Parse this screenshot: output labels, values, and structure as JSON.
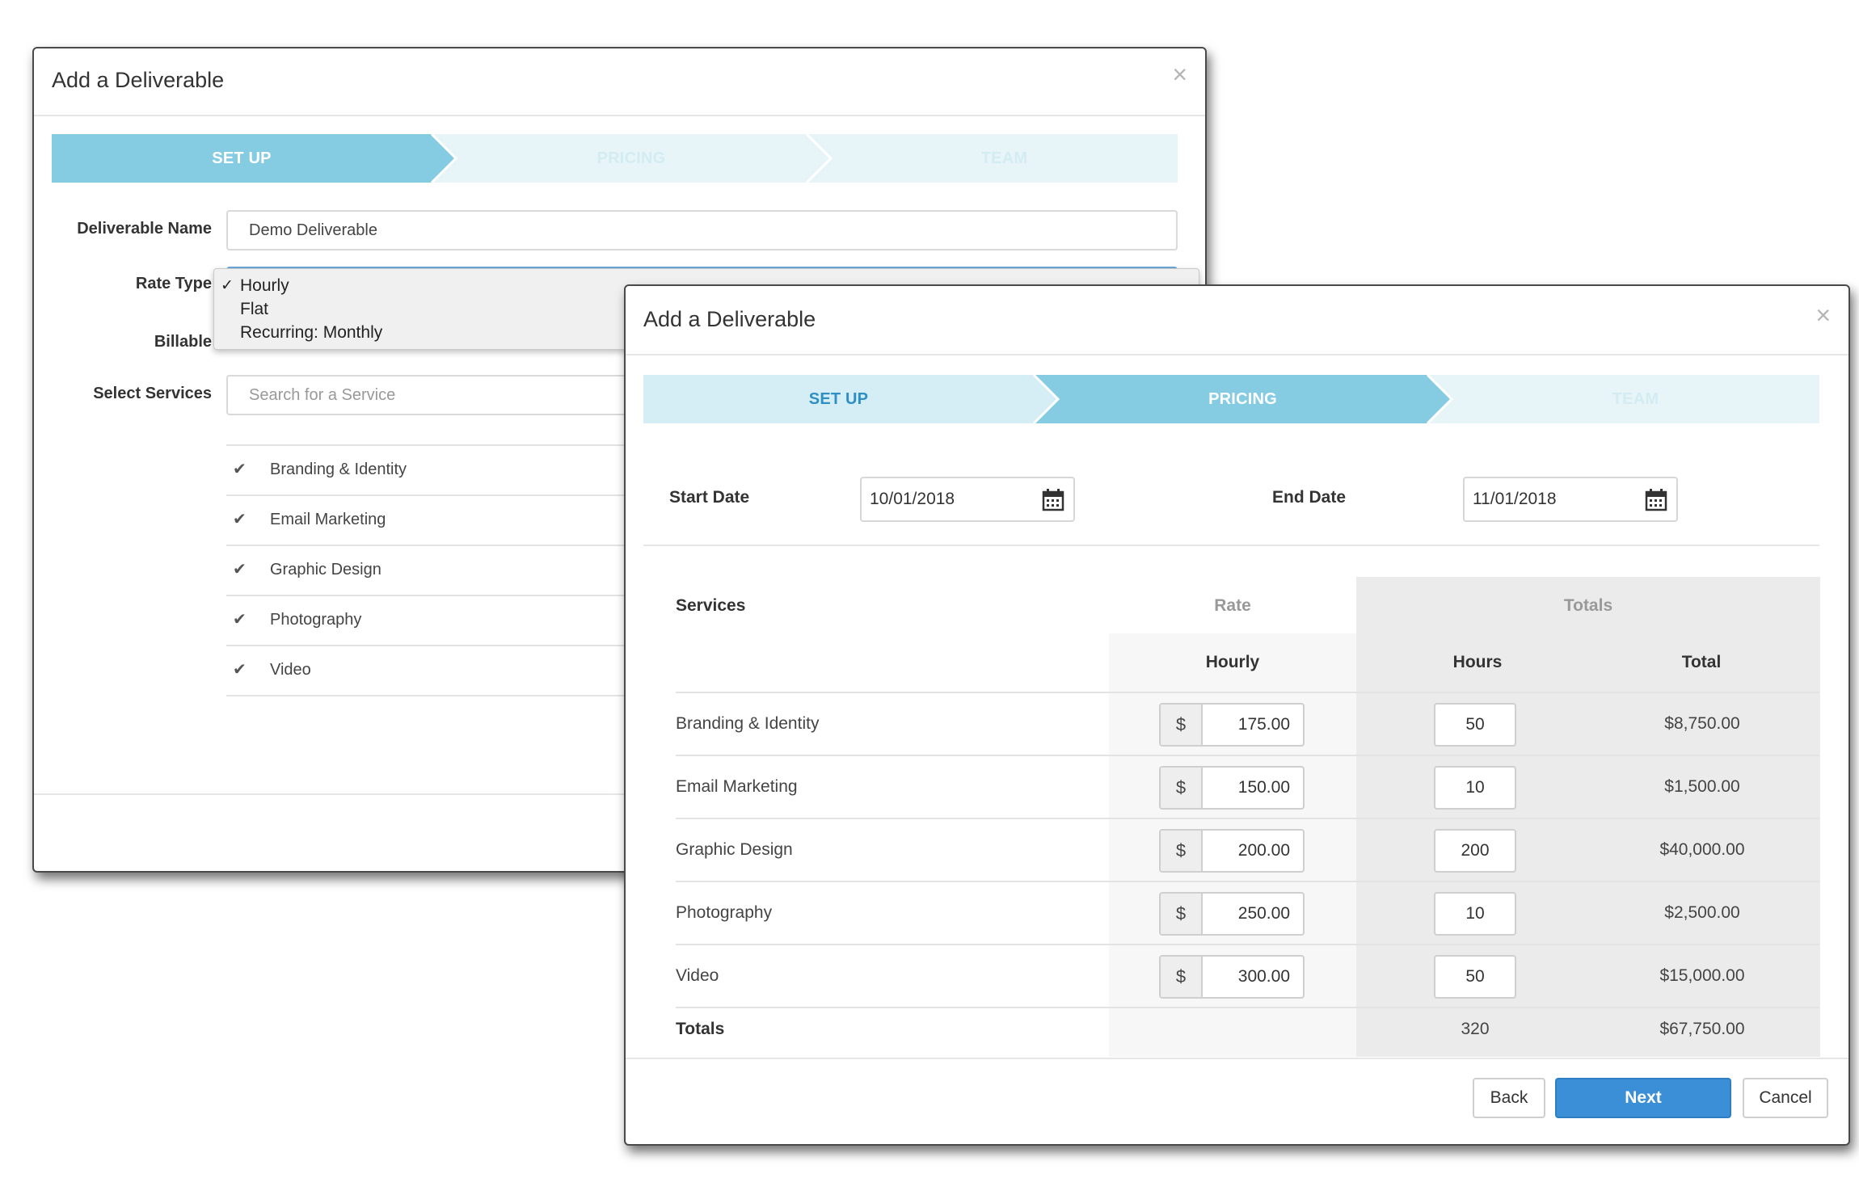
{
  "modal1": {
    "title": "Add a Deliverable",
    "close": "×",
    "steps": [
      "SET UP",
      "PRICING",
      "TEAM"
    ],
    "colors": {
      "active_step": "#85cce3",
      "inactive_step": "#e8f5f8",
      "active_text": "#ffffff",
      "inactive_text": "#d3ecf2"
    },
    "deliverable_name_label": "Deliverable Name",
    "deliverable_name_value": "Demo Deliverable",
    "rate_type_label": "Rate Type",
    "rate_type_options": [
      "Hourly",
      "Flat",
      "Recurring: Monthly"
    ],
    "rate_type_selected": "Hourly",
    "check_mark": "✓",
    "billable_label": "Billable",
    "select_services_label": "Select Services",
    "search_placeholder": "Search for a Service",
    "services": [
      "Branding & Identity",
      "Email Marketing",
      "Graphic Design",
      "Photography",
      "Video"
    ],
    "service_check": "✔"
  },
  "modal2": {
    "title": "Add a Deliverable",
    "close": "×",
    "steps": [
      "SET UP",
      "PRICING",
      "TEAM"
    ],
    "colors": {
      "active_step": "#85cce3",
      "inactive_step": "#e8f5f8",
      "done_text": "#2d8fc4",
      "active_text": "#ffffff",
      "inactive_text": "#d3ecf2",
      "primary": "#3b8fd6"
    },
    "start_date_label": "Start Date",
    "start_date_value": "10/01/2018",
    "end_date_label": "End Date",
    "end_date_value": "11/01/2018",
    "table": {
      "services_header": "Services",
      "rate_header": "Rate",
      "totals_header": "Totals",
      "hourly_header": "Hourly",
      "hours_header": "Hours",
      "total_header": "Total",
      "currency": "$",
      "rows": [
        {
          "service": "Branding & Identity",
          "rate": "175.00",
          "hours": "50",
          "total": "$8,750.00"
        },
        {
          "service": "Email Marketing",
          "rate": "150.00",
          "hours": "10",
          "total": "$1,500.00"
        },
        {
          "service": "Graphic Design",
          "rate": "200.00",
          "hours": "200",
          "total": "$40,000.00"
        },
        {
          "service": "Photography",
          "rate": "250.00",
          "hours": "10",
          "total": "$2,500.00"
        },
        {
          "service": "Video",
          "rate": "300.00",
          "hours": "50",
          "total": "$15,000.00"
        }
      ],
      "totals_label": "Totals",
      "total_hours": "320",
      "grand_total": "$67,750.00"
    },
    "buttons": {
      "back": "Back",
      "next": "Next",
      "cancel": "Cancel"
    }
  }
}
